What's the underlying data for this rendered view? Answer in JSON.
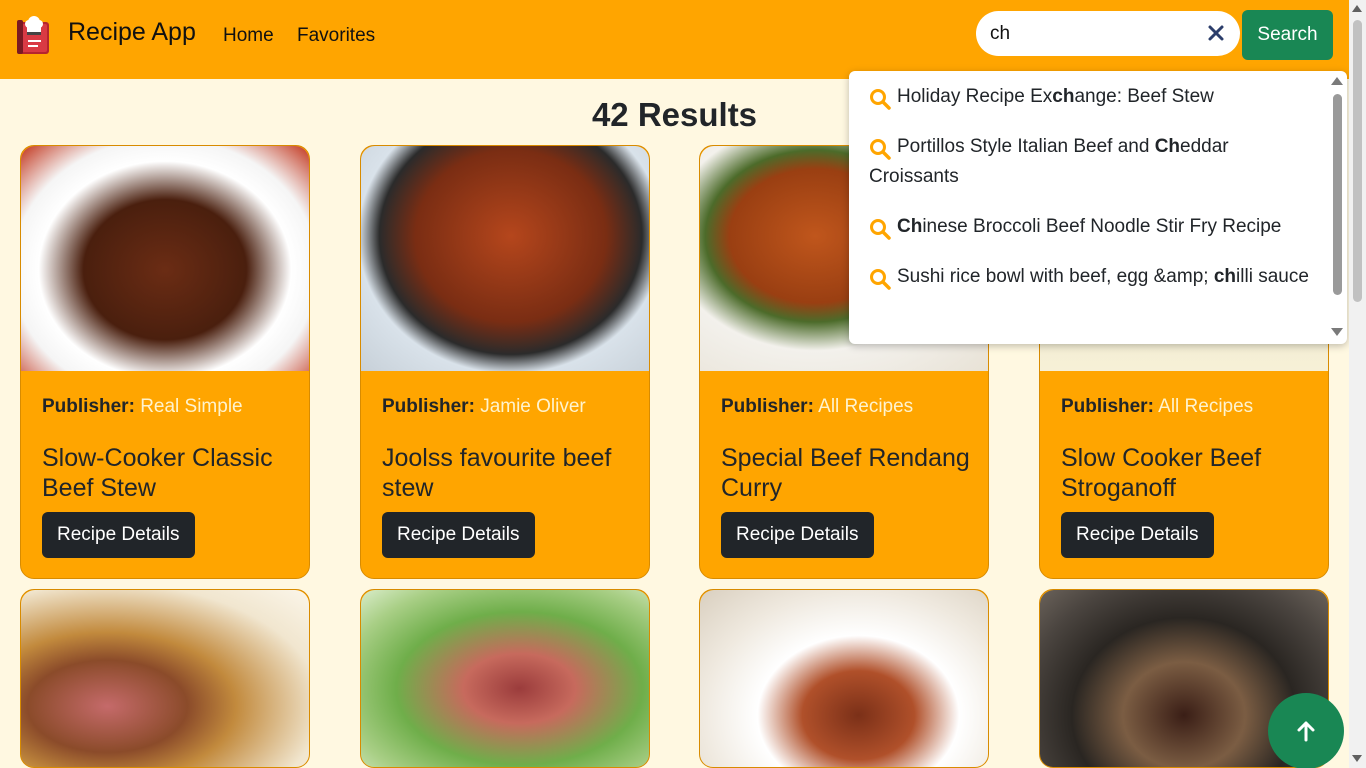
{
  "colors": {
    "nav_bg": "#ffa500",
    "page_bg": "#fff8e1",
    "card_bg": "#ffa500",
    "button_dark": "#212529",
    "search_green": "#198754",
    "publisher_name": "#fff3cd",
    "suggest_icon": "#ffa500"
  },
  "navbar": {
    "brand_icon": "chef-book-icon",
    "brand_name": "Recipe App",
    "links": [
      {
        "label": "Home"
      },
      {
        "label": "Favorites"
      }
    ]
  },
  "search": {
    "value": "ch",
    "placeholder": "",
    "clear_icon": "close-icon",
    "button_label": "Search"
  },
  "results": {
    "title": "42 Results"
  },
  "cards": [
    {
      "publisher_label": "Publisher:",
      "publisher": "Real Simple",
      "title": "Slow-Cooker Classic Beef Stew",
      "button": "Recipe Details"
    },
    {
      "publisher_label": "Publisher:",
      "publisher": "Jamie Oliver",
      "title": "Joolss favourite beef stew",
      "button": "Recipe Details"
    },
    {
      "publisher_label": "Publisher:",
      "publisher": "All Recipes",
      "title": "Special Beef Rendang Curry",
      "button": "Recipe Details"
    },
    {
      "publisher_label": "Publisher:",
      "publisher": "All Recipes",
      "title": "Slow Cooker Beef Stroganoff",
      "button": "Recipe Details"
    }
  ],
  "suggestions": {
    "icon": "search-icon",
    "items": [
      {
        "pre": "Holiday Recipe Ex",
        "match": "ch",
        "post": "ange: Beef Stew"
      },
      {
        "pre": "Portillos Style Italian Beef and ",
        "match": "Ch",
        "post": "eddar Croissants"
      },
      {
        "pre": "",
        "match": "Ch",
        "post": "inese Broccoli Beef Noodle Stir Fry Recipe"
      },
      {
        "pre": "Sushi rice bowl with beef, egg &amp; ",
        "match": "ch",
        "post": "illi sauce"
      }
    ]
  },
  "back_to_top": {
    "icon": "arrow-up-icon"
  }
}
